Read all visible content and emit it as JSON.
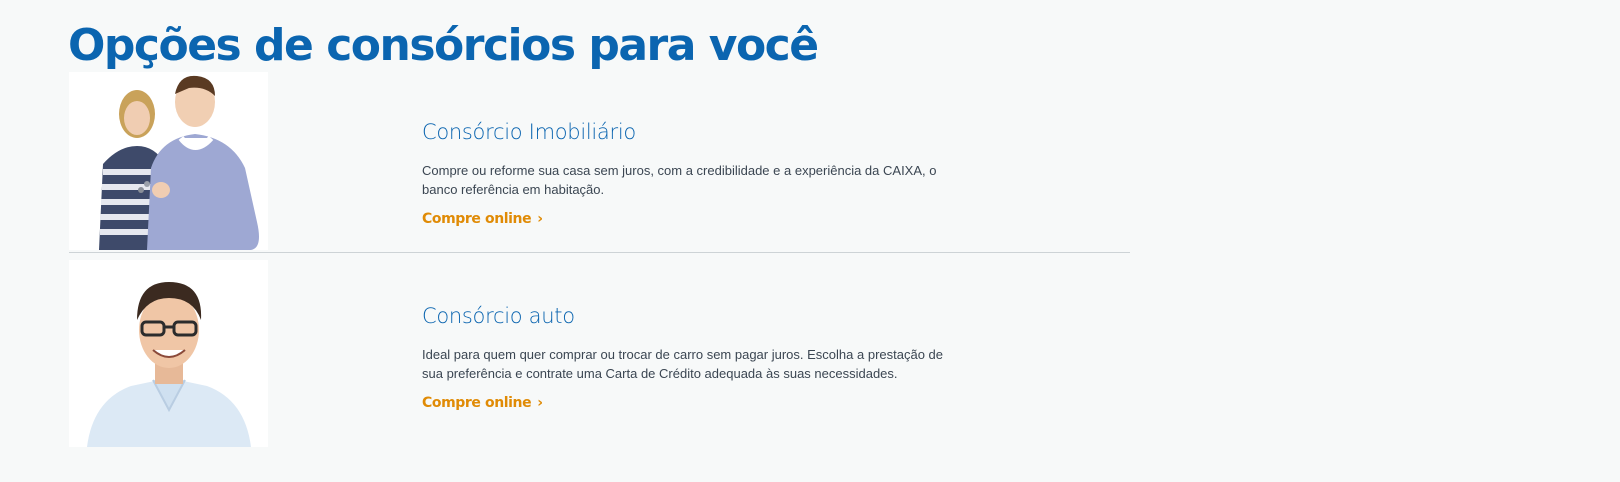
{
  "page": {
    "title": "Opções de consórcios para você"
  },
  "cards": [
    {
      "title": "Consórcio Imobiliário",
      "description": "Compre ou reforme sua casa sem juros, com a credibilidade e a experiência da CAIXA, o banco referência em habitação.",
      "cta_label": "Compre online",
      "cta_chevron": "›",
      "image_icon": "couple-photo"
    },
    {
      "title": "Consórcio auto",
      "description": "Ideal para quem quer comprar ou trocar de carro sem pagar juros. Escolha a prestação de sua preferência e contrate uma Carta de Crédito adequada às suas necessidades.",
      "cta_label": "Compre online",
      "cta_chevron": "›",
      "image_icon": "man-photo"
    }
  ],
  "colors": {
    "background": "#f7f9f9",
    "title_blue": "#0b65b0",
    "body_text": "#3b4652",
    "cta_orange": "#e08b06",
    "divider": "#cdd3d6"
  }
}
